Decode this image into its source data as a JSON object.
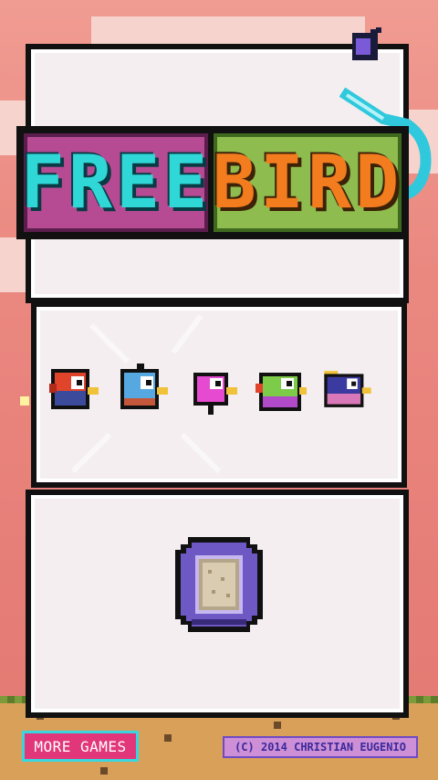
{
  "title": {
    "word1": "FREE",
    "word2": "BIRD"
  },
  "birds": [
    {
      "name": "red-bird",
      "color": "#e0442a"
    },
    {
      "name": "blue-bird",
      "color": "#56a9e0"
    },
    {
      "name": "pink-bird",
      "color": "#e64ad0"
    },
    {
      "name": "green-bird",
      "color": "#7ccc4a"
    },
    {
      "name": "navy-bird",
      "color": "#3a3aa0"
    }
  ],
  "footer": {
    "more_games": "MORE GAMES",
    "copyright": "(C) 2014 CHRISTIAN EUGENIO"
  },
  "icons": {
    "sound": "music-note-icon",
    "play": "play-coin-icon"
  },
  "colors": {
    "free_bg": "#b64b93",
    "bird_bg": "#8ebc4e",
    "free_text": "#2fd7d7",
    "bird_text": "#f27c1e"
  }
}
